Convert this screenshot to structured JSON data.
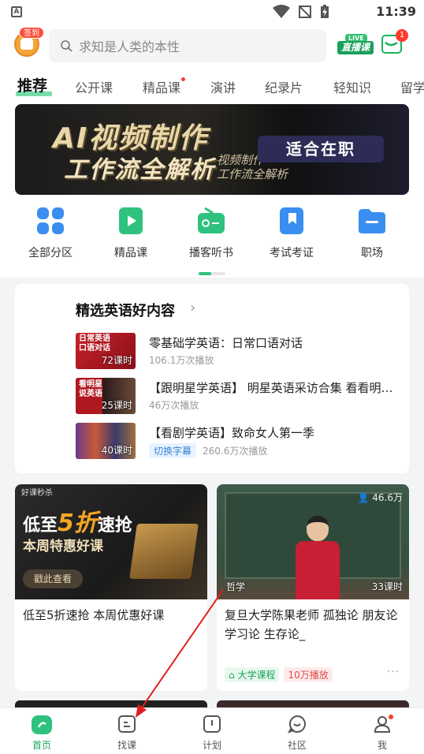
{
  "status_bar": {
    "time": "11:39",
    "app_icon_letter": "A"
  },
  "header": {
    "checkin_label": "签到",
    "search_placeholder": "求知是人类的本性",
    "live_top": "LIVE",
    "live_label": "直播课",
    "message_badge": "1"
  },
  "tabs": [
    "推荐",
    "公开课",
    "精品课",
    "演讲",
    "纪录片",
    "轻知识",
    "留学"
  ],
  "banner": {
    "line1": "AI视频制作",
    "line2": "工作流全解析",
    "sub": "视频制作\n工作流全解析",
    "tag": "适合在职"
  },
  "categories": [
    {
      "label": "全部分区",
      "icon": "grid-icon",
      "color": "#3a8ef0"
    },
    {
      "label": "精品课",
      "icon": "play-icon",
      "color": "#2ec27e"
    },
    {
      "label": "播客听书",
      "icon": "radio-icon",
      "color": "#2ec27e"
    },
    {
      "label": "考试考证",
      "icon": "bookmark-icon",
      "color": "#3a8ef0"
    },
    {
      "label": "职场",
      "icon": "folder-icon",
      "color": "#3a8ef0"
    }
  ],
  "english_section": {
    "title": "精选英语好内容",
    "items": [
      {
        "title": "零基础学英语：日常口语对话",
        "meta": "106.1万次播放",
        "hours": "72课时",
        "thumb_text": "日常英语\n口语对话",
        "badge": ""
      },
      {
        "title": "【跟明星学英语】 明星英语采访合集 看看明星们是如何说英语的",
        "meta": "46万次播放",
        "hours": "25课时",
        "thumb_text": "看明星\n说英语",
        "badge": ""
      },
      {
        "title": "【看剧学英语】致命女人第一季",
        "meta": "260.6万次播放",
        "hours": "40课时",
        "thumb_text": "",
        "badge": "切换字幕"
      }
    ]
  },
  "course_cards": [
    {
      "title": "低至5折速抢 本周优惠好课",
      "image": {
        "tag": "好课秒杀",
        "line1_pre": "低至",
        "line1_big": "5折",
        "line1_post": "速抢",
        "line2": "本周特惠好课",
        "button": "戳此查看"
      }
    },
    {
      "title": "复旦大学陈果老师 孤独论 朋友论 学习论 生存论_",
      "image": {
        "views": "46.6万",
        "subject": "哲学",
        "hours": "33课时"
      },
      "tags": [
        "大学课程",
        "10万播放"
      ],
      "more": "···"
    }
  ],
  "bottom_nav": [
    {
      "label": "首页",
      "icon": "home-icon",
      "active": true
    },
    {
      "label": "找课",
      "icon": "find-course-icon",
      "active": false
    },
    {
      "label": "计划",
      "icon": "plan-icon",
      "active": false
    },
    {
      "label": "社区",
      "icon": "community-icon",
      "active": false
    },
    {
      "label": "我",
      "icon": "profile-icon",
      "active": false
    }
  ],
  "colors": {
    "accent": "#2ec27e",
    "badge_red": "#ff3b30",
    "annotation_arrow": "#e02020"
  }
}
